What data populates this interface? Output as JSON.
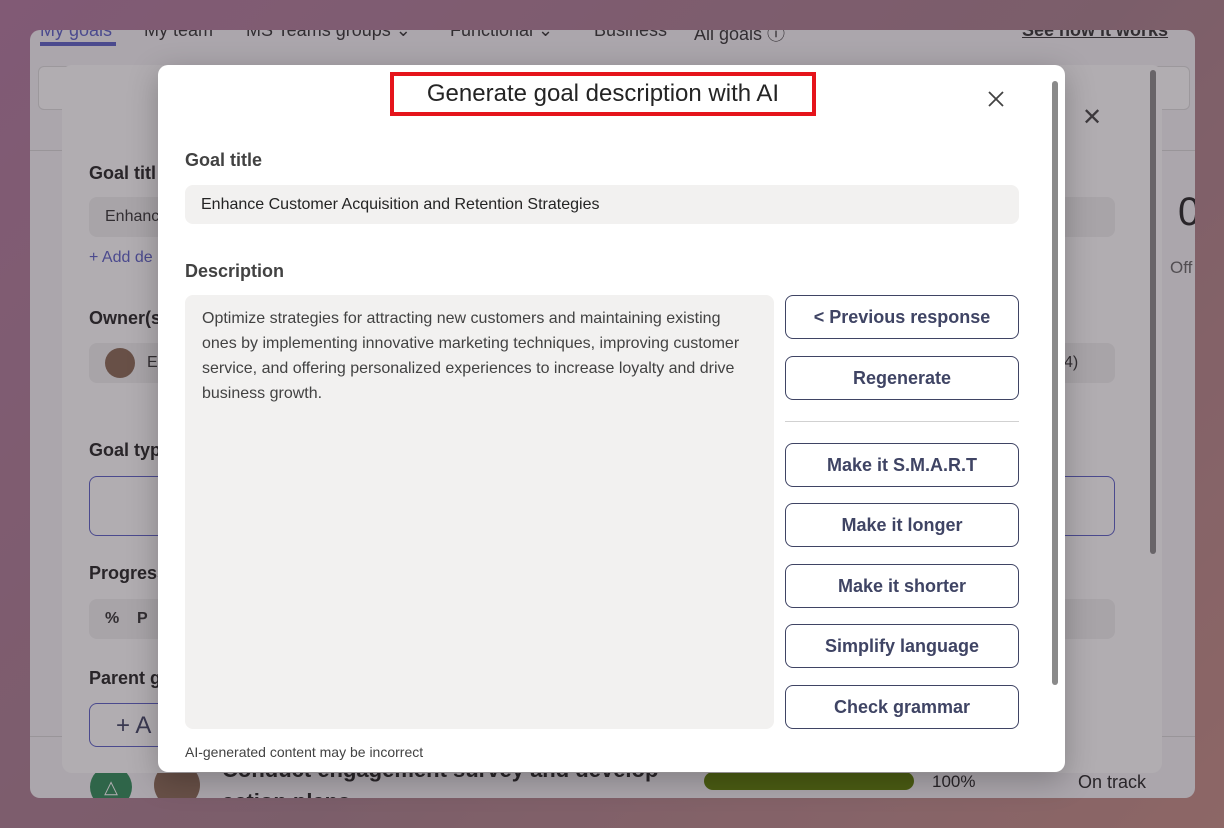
{
  "background_app": {
    "nav_tabs": [
      {
        "label": "My goals"
      },
      {
        "label": "My team"
      },
      {
        "label": "MS Teams groups ⌄"
      },
      {
        "label": "Functional ⌄"
      },
      {
        "label": "Business"
      },
      {
        "label": "All goals ⓘ"
      }
    ],
    "see_how_link": "See how it works",
    "goal_row": {
      "name": "Conduct engagement survey and develop action plans",
      "progress_pct": "100%",
      "status": "On track",
      "progress_value": 1.0
    },
    "big_number": "0",
    "off_label": "Off",
    "progress_color": "#5b7c00"
  },
  "background_panel": {
    "goal_title_label": "Goal titl",
    "goal_title_value": "Enhanc",
    "add_desc_link": "+ Add de",
    "owners_label": "Owner(s",
    "owner_name": "Em",
    "owner_count": "4)",
    "goal_type_label": "Goal typ",
    "progress_label": "Progress",
    "progress_unit_icon": "%",
    "progress_unit_text": "P",
    "parent_goal_label": "Parent g",
    "parent_add": "+ A",
    "close_glyph": "✕"
  },
  "dialog": {
    "title": "Generate goal description with AI",
    "goal_title_label": "Goal title",
    "goal_title_value": "Enhance Customer Acquisition and Retention Strategies",
    "description_label": "Description",
    "description_text": "Optimize strategies for attracting new customers and maintaining existing ones by implementing innovative marketing techniques, improving customer service, and offering personalized experiences to increase loyalty and drive business growth.",
    "buttons": {
      "previous": "< Previous response",
      "regenerate": "Regenerate",
      "smart": "Make it S.M.A.R.T",
      "longer": "Make it longer",
      "shorter": "Make it shorter",
      "simplify": "Simplify language",
      "grammar": "Check grammar"
    },
    "disclaimer": "AI-generated content may be incorrect",
    "highlight_color": "#e5141b",
    "button_color": "#3f4464"
  }
}
